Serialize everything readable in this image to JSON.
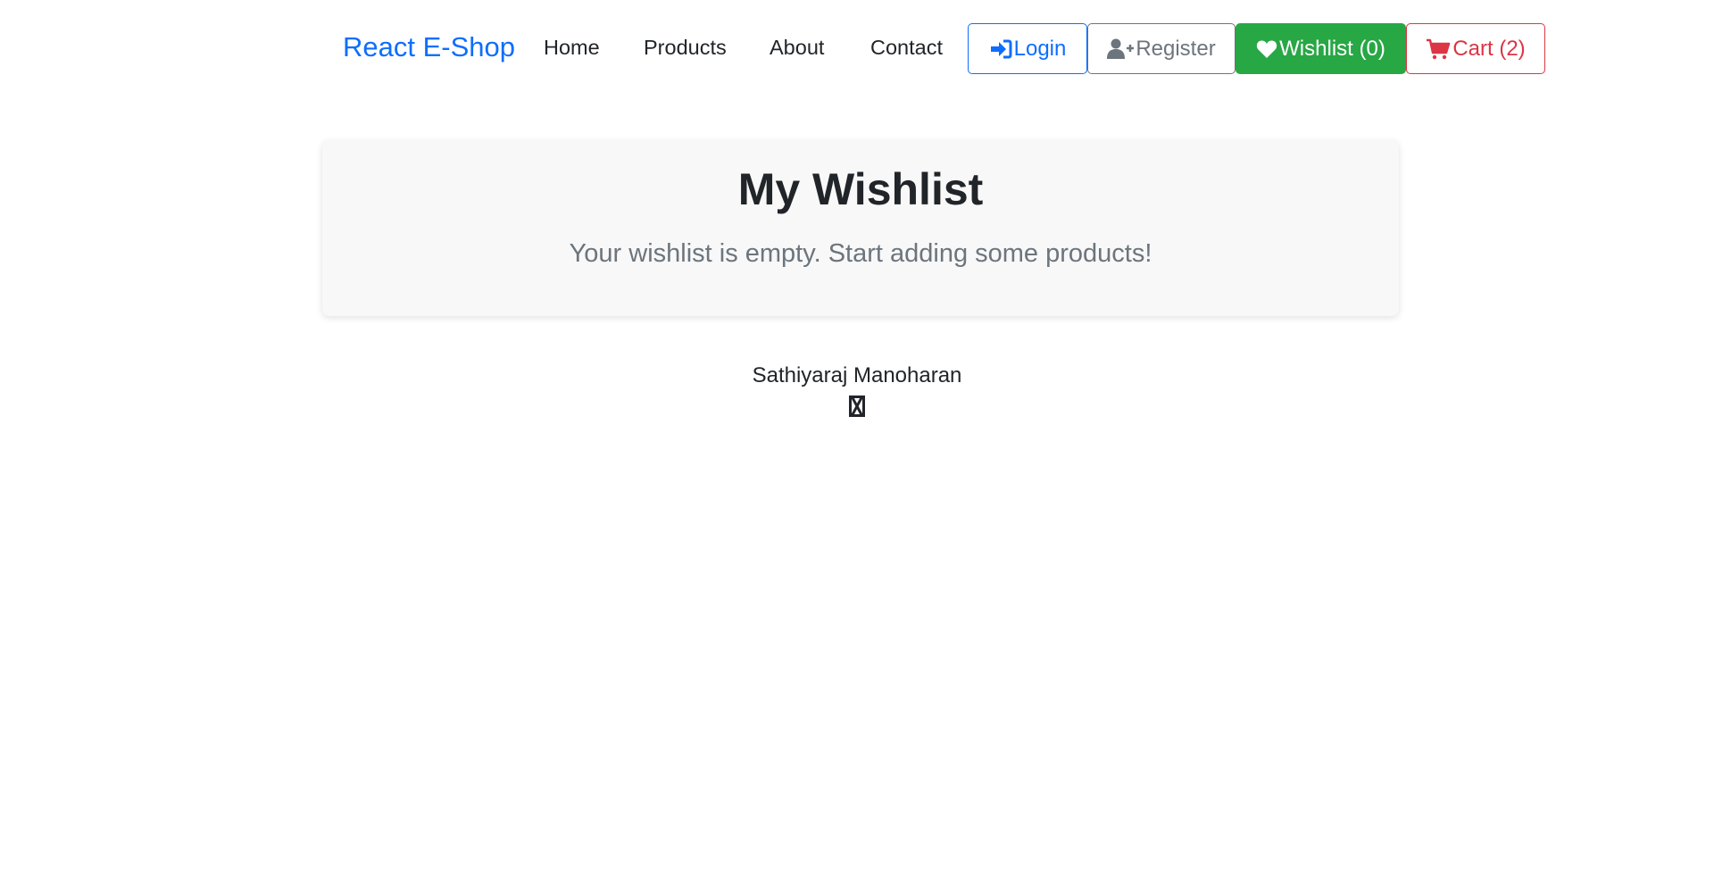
{
  "navbar": {
    "brand": "React E-Shop",
    "links": [
      {
        "label": "Home"
      },
      {
        "label": "Products"
      },
      {
        "label": "About"
      },
      {
        "label": "Contact"
      }
    ],
    "buttons": {
      "login": {
        "label": "Login",
        "icon": "sign-in-icon"
      },
      "register": {
        "label": "Register",
        "icon": "user-plus-icon"
      },
      "wishlist": {
        "label": "Wishlist (0)",
        "icon": "heart-icon"
      },
      "cart": {
        "label": "Cart (2)",
        "icon": "cart-icon"
      }
    }
  },
  "wishlist": {
    "title": "My Wishlist",
    "empty_message": "Your wishlist is empty. Start adding some products!"
  },
  "footer": {
    "author": "Sathiyaraj Manoharan",
    "icon": "missing-glyph-icon"
  },
  "colors": {
    "brand": "#0d6efd",
    "login": "#0d6efd",
    "register": "#6c757d",
    "wishlist": "#28a745",
    "cart": "#dc3545"
  }
}
